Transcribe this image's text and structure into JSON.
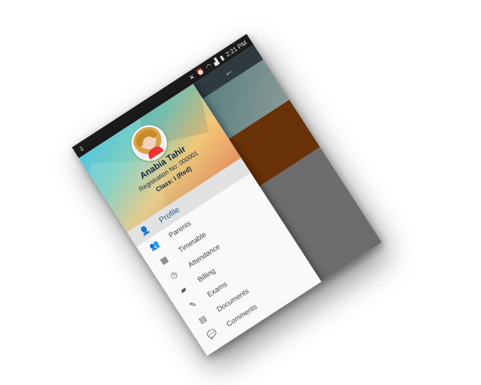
{
  "status_bar": {
    "time": "2:21 PM",
    "icons": [
      "usb-icon",
      "mute-icon",
      "alarm-icon",
      "wifi-icon",
      "signal-icon",
      "battery-icon"
    ]
  },
  "header": {
    "student_name": "Anabia Tahir",
    "registration": "Registration No: 000001",
    "class": "Class: I (Red)"
  },
  "menu": {
    "items": [
      {
        "label": "Profile",
        "icon": "profile-icon",
        "active": true
      },
      {
        "label": "Parents",
        "icon": "parents-icon",
        "active": false
      },
      {
        "label": "Timetable",
        "icon": "timetable-icon",
        "active": false
      },
      {
        "label": "Attendance",
        "icon": "attendance-icon",
        "active": false
      },
      {
        "label": "Billing",
        "icon": "billing-icon",
        "active": false
      },
      {
        "label": "Exams",
        "icon": "exams-icon",
        "active": false
      },
      {
        "label": "Documents",
        "icon": "documents-icon",
        "active": false
      },
      {
        "label": "Comments",
        "icon": "comments-icon",
        "active": false
      }
    ]
  },
  "colors": {
    "status_bar_bg": "#1b1b1b",
    "active_item_bg": "#e2e2e2",
    "active_text": "#2a5f8f",
    "right_brown": "#6a3208",
    "right_grey": "#6c6c6c"
  }
}
